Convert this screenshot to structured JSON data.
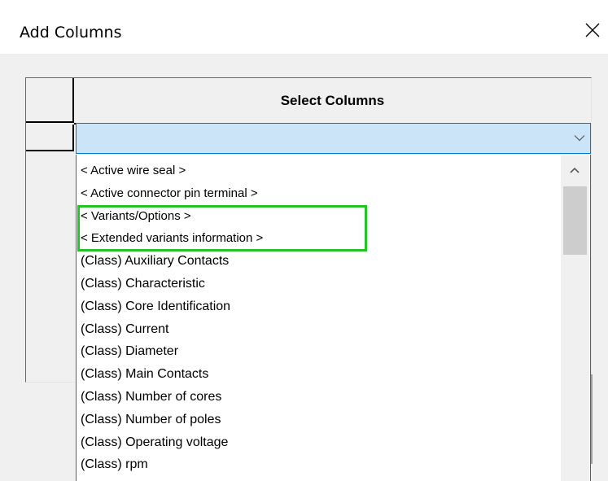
{
  "window": {
    "title": "Add Columns",
    "close_icon": "close-icon"
  },
  "grid": {
    "column_header": "Select Columns"
  },
  "combo": {
    "value": "",
    "arrow_icon": "chevron-down-icon"
  },
  "dropdown": {
    "items": [
      "< Active wire seal >",
      "< Active connector pin terminal >",
      "< Variants/Options >",
      "< Extended variants information >",
      "(Class) Auxiliary Contacts",
      "(Class) Characteristic",
      "(Class) Core Identification",
      "(Class) Current",
      "(Class) Diameter",
      "(Class) Main Contacts",
      "(Class) Number of cores",
      "(Class) Number of poles",
      "(Class) Operating voltage",
      "(Class) rpm"
    ],
    "highlighted_items": [
      "< Variants/Options >",
      "< Extended variants information >"
    ],
    "highlight_color": "#27c227"
  },
  "scrollbar": {
    "up_icon": "chevron-up-icon"
  },
  "colors": {
    "combo_background": "#cce4f7",
    "combo_border": "#0078d7"
  }
}
